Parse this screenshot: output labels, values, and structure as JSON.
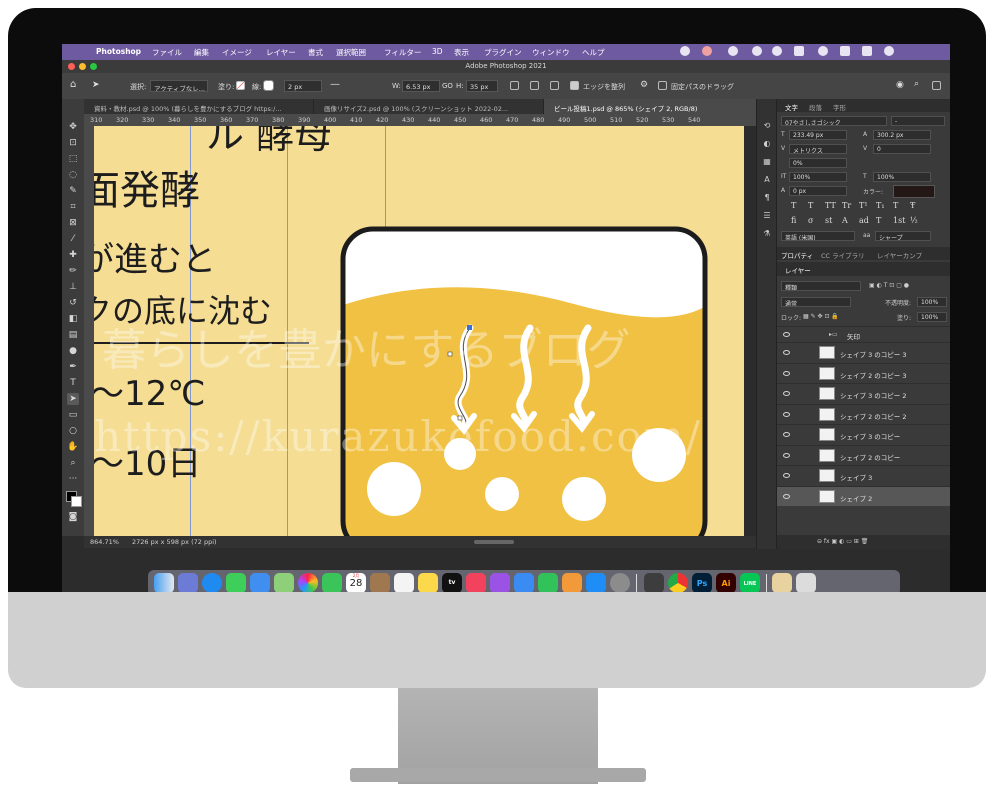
{
  "app": {
    "menu": [
      "Photoshop",
      "ファイル",
      "編集",
      "イメージ",
      "レイヤー",
      "書式",
      "選択範囲",
      "フィルター",
      "3D",
      "表示",
      "プラグイン",
      "ウィンドウ",
      "ヘルプ"
    ],
    "window_title": "Adobe Photoshop 2021"
  },
  "options_bar": {
    "select_label": "選択:",
    "select_value": "アクティブなレ...",
    "fill_label": "塗り:",
    "stroke_label": "線:",
    "stroke_width": "2 px",
    "w_label": "W:",
    "w_value": "6.53 px",
    "link": "GO",
    "h_label": "H:",
    "h_value": "35 px",
    "align_edges": "エッジを整列",
    "constrain_path": "固定パスのドラッグ"
  },
  "tabs": [
    {
      "label": "資料・教材.psd @ 100% (暮らしを豊かにするブログ https:/..."
    },
    {
      "label": "画像リサイズ2.psd @ 100% (スクリーンショット 2022-02..."
    },
    {
      "label": "ビール投稿1.psd @ 865% (シェイプ 2, RGB/8)",
      "active": true
    }
  ],
  "ruler_ticks": [
    "310",
    "320",
    "330",
    "340",
    "350",
    "360",
    "370",
    "380",
    "390",
    "400",
    "410",
    "420",
    "430",
    "440",
    "450",
    "460",
    "470",
    "480",
    "490",
    "500",
    "510",
    "520",
    "530",
    "540"
  ],
  "canvas_text": {
    "heading_fragment": "ル 酵母",
    "title": "面発酵",
    "line1": "が進むと",
    "line2": "クの底に沈む",
    "temp": "〜12℃",
    "days": "〜10日"
  },
  "status": {
    "zoom": "864.71%",
    "doc_size": "2726 px x 598 px (72 ppi)"
  },
  "character_panel": {
    "tabs": [
      "文字",
      "段落",
      "字形"
    ],
    "font": "07やさしさゴシック",
    "style": "-",
    "size": "233.49 px",
    "leading": "300.2 px",
    "kerning": "メトリクス",
    "tracking": "0",
    "tsume": "0%",
    "vscale": "100%",
    "hscale": "100%",
    "baseline": "0 px",
    "color_label": "カラー:",
    "color_swatch": "#231815",
    "glyph_buttons": [
      "T",
      "T",
      "TT",
      "Tr",
      "T¹",
      "T₁",
      "T",
      "Ŧ"
    ],
    "glyph_buttons2": [
      "fi",
      "σ",
      "st",
      "A",
      "ad",
      "T",
      "1st",
      "½"
    ],
    "language": "英語 (米国)",
    "antialias": "aa",
    "antialias_mode": "シャープ"
  },
  "panel_tabs2": [
    "プロパティ",
    "CC ライブラリ",
    "レイヤーカンプ"
  ],
  "layers_panel": {
    "title": "レイヤー",
    "kind_filter": "種類",
    "blend_mode": "通常",
    "opacity_label": "不透明度:",
    "opacity": "100%",
    "lock_label": "ロック:",
    "fill_label": "塗り:",
    "fill": "100%",
    "group": "矢印",
    "layers": [
      {
        "name": "シェイプ 3 のコピー 3",
        "selected": false
      },
      {
        "name": "シェイプ 2 のコピー 3",
        "selected": false
      },
      {
        "name": "シェイプ 3 のコピー 2",
        "selected": false
      },
      {
        "name": "シェイプ 2 のコピー 2",
        "selected": false
      },
      {
        "name": "シェイプ 3 のコピー",
        "selected": false
      },
      {
        "name": "シェイプ 2 のコピー",
        "selected": false
      },
      {
        "name": "シェイプ 3",
        "selected": false
      },
      {
        "name": "シェイプ 2",
        "selected": true
      }
    ]
  },
  "dock": {
    "calendar_month": "2月",
    "calendar_day": "28",
    "app_labels": [
      "tv",
      "Ps",
      "Ai",
      "LINE"
    ]
  },
  "watermark": {
    "text1": "暮らしを豊かにするブログ",
    "text2": "https://kurazukefood.com/"
  },
  "colors": {
    "menubar": "#6e5aa0",
    "canvas_bg": "#f5dd94",
    "beer": "#f0c143",
    "guide": "#6f8cd8"
  }
}
